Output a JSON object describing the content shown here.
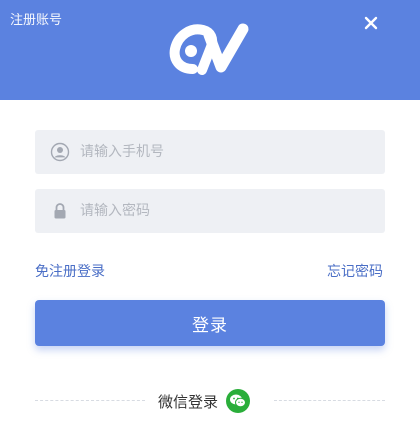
{
  "header": {
    "register_label": "注册账号",
    "brand_color": "#5b82e0",
    "logo_icon": "brand-logo-icon",
    "close_icon": "close-icon"
  },
  "form": {
    "phone": {
      "placeholder": "请输入手机号",
      "value": "",
      "icon": "user-icon"
    },
    "password": {
      "placeholder": "请输入密码",
      "value": "",
      "icon": "lock-icon"
    }
  },
  "links": {
    "quick_login": "免注册登录",
    "forgot_password": "忘记密码"
  },
  "login_button": {
    "label": "登录"
  },
  "alt_login": {
    "label": "微信登录",
    "icon": "wechat-icon",
    "icon_color": "#2aae3a"
  }
}
